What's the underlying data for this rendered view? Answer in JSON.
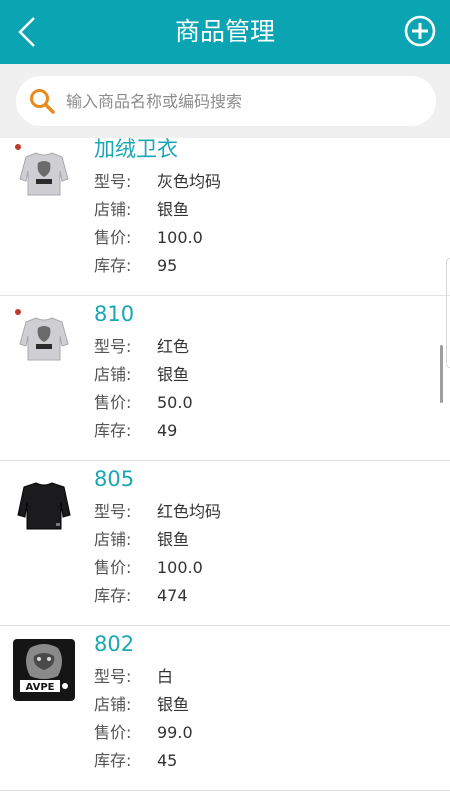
{
  "header": {
    "title": "商品管理"
  },
  "search": {
    "placeholder": "输入商品名称或编码搜索"
  },
  "labels": {
    "model": "型号:",
    "shop": "店铺:",
    "price": "售价:",
    "stock": "库存:"
  },
  "products": [
    {
      "name": "加绒卫衣",
      "model": "灰色均码",
      "shop": "银鱼",
      "price": "100.0",
      "stock": "95"
    },
    {
      "name": "810",
      "model": "红色",
      "shop": "银鱼",
      "price": "50.0",
      "stock": "49"
    },
    {
      "name": "805",
      "model": "红色均码",
      "shop": "银鱼",
      "price": "100.0",
      "stock": "474"
    },
    {
      "name": "802",
      "model": "白",
      "shop": "银鱼",
      "price": "99.0",
      "stock": "45"
    }
  ],
  "thumbnails": [
    "grey-sweatshirt-icon",
    "grey-sweatshirt-icon",
    "black-sweatshirt-icon",
    "ape-graphic-icon"
  ],
  "thumbnail_texts": {
    "ape_logo": "AVPE"
  },
  "colors": {
    "header": "#0aa4b2",
    "accent": "#19a7b5",
    "search_icon": "#e98a1b"
  }
}
